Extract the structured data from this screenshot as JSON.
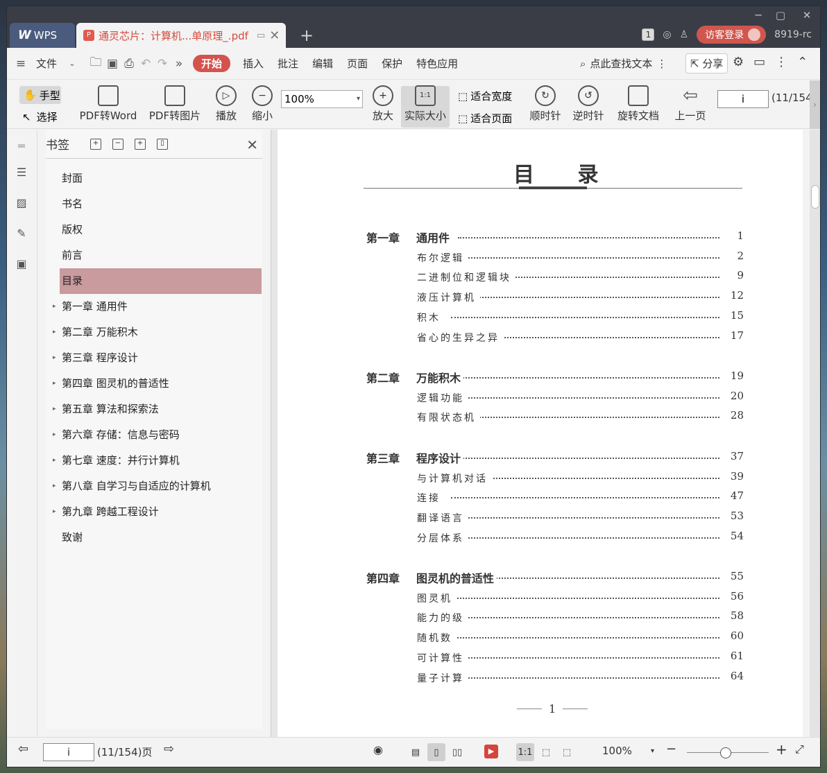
{
  "app": {
    "name": "WPS"
  },
  "tabs": {
    "doc_title": "通灵芯片：计算机...单原理_.pdf",
    "add": "+"
  },
  "titlebar": {
    "badge": "1",
    "login": "访客登录",
    "user": "8919-rc",
    "min": "─",
    "max": "▢",
    "close": "✕"
  },
  "menu": {
    "file": "文件",
    "items": [
      "开始",
      "插入",
      "批注",
      "编辑",
      "页面",
      "保护",
      "特色应用"
    ],
    "search": "点此查找文本",
    "share": "分享"
  },
  "toolbar": {
    "hand": "手型",
    "select": "选择",
    "pdf_to_word": "PDF转Word",
    "pdf_to_image": "PDF转图片",
    "play": "播放",
    "zoom_out": "缩小",
    "zoom_value": "100%",
    "zoom_in": "放大",
    "actual_size": "实际大小",
    "fit_width": "适合宽度",
    "fit_page": "适合页面",
    "clockwise": "顺时针",
    "counterclockwise": "逆时针",
    "rotate_doc": "旋转文档",
    "prev_page": "上一页",
    "page_input": "i",
    "page_count": "(11/154"
  },
  "bookmarks": {
    "title": "书签",
    "items": [
      {
        "label": "封面",
        "expandable": false
      },
      {
        "label": "书名",
        "expandable": false
      },
      {
        "label": "版权",
        "expandable": false
      },
      {
        "label": "前言",
        "expandable": false
      },
      {
        "label": "目录",
        "expandable": false,
        "selected": true
      },
      {
        "label": "第一章  通用件",
        "expandable": true
      },
      {
        "label": "第二章  万能积木",
        "expandable": true
      },
      {
        "label": "第三章  程序设计",
        "expandable": true
      },
      {
        "label": "第四章  图灵机的普适性",
        "expandable": true
      },
      {
        "label": "第五章  算法和探索法",
        "expandable": true
      },
      {
        "label": "第六章  存储：信息与密码",
        "expandable": true
      },
      {
        "label": "第七章  速度：并行计算机",
        "expandable": true
      },
      {
        "label": "第八章  自学习与自适应的计算机",
        "expandable": true
      },
      {
        "label": "第九章  跨越工程设计",
        "expandable": true
      },
      {
        "label": "致谢",
        "expandable": false
      }
    ]
  },
  "document": {
    "title": "目  录",
    "page_number": "1",
    "toc": [
      {
        "chapter": "第一章",
        "title": "通用件",
        "page": "1",
        "sections": [
          {
            "t": "布尔逻辑",
            "p": "2"
          },
          {
            "t": "二进制位和逻辑块",
            "p": "9"
          },
          {
            "t": "液压计算机",
            "p": "12"
          },
          {
            "t": "积木",
            "p": "15"
          },
          {
            "t": "省心的生异之异",
            "p": "17"
          }
        ]
      },
      {
        "chapter": "第二章",
        "title": "万能积木",
        "page": "19",
        "sections": [
          {
            "t": "逻辑功能",
            "p": "20"
          },
          {
            "t": "有限状态机",
            "p": "28"
          }
        ]
      },
      {
        "chapter": "第三章",
        "title": "程序设计",
        "page": "37",
        "sections": [
          {
            "t": "与计算机对话",
            "p": "39"
          },
          {
            "t": "连接",
            "p": "47"
          },
          {
            "t": "翻译语言",
            "p": "53"
          },
          {
            "t": "分层体系",
            "p": "54"
          }
        ]
      },
      {
        "chapter": "第四章",
        "title": "图灵机的普适性",
        "page": "55",
        "sections": [
          {
            "t": "图灵机",
            "p": "56"
          },
          {
            "t": "能力的级",
            "p": "58"
          },
          {
            "t": "随机数",
            "p": "60"
          },
          {
            "t": "可计算性",
            "p": "61"
          },
          {
            "t": "量子计算",
            "p": "64"
          }
        ]
      }
    ]
  },
  "status": {
    "page_input": "i",
    "page_count": "(11/154)页",
    "zoom": "100%"
  },
  "colors": {
    "accent": "#d4534d",
    "titlebar": "#3a3d46",
    "selected_bookmark": "#c99a9e"
  }
}
